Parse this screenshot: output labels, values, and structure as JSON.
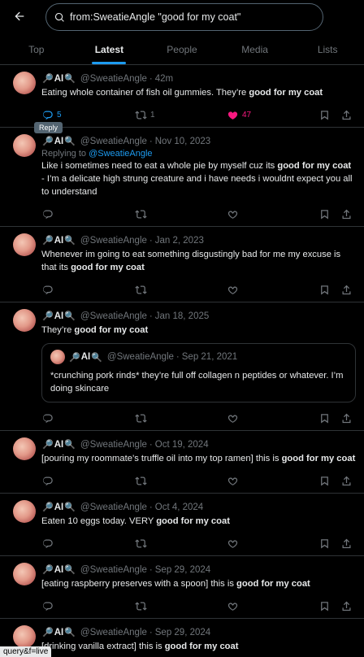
{
  "search": {
    "query": "from:SweatieAngle \"good for my coat\""
  },
  "tabs": [
    "Top",
    "Latest",
    "People",
    "Media",
    "Lists"
  ],
  "author": {
    "name_prefix": "AI",
    "handle": "@SweatieAngle"
  },
  "tweets": [
    {
      "time": "42m",
      "text_before": "Eating whole container of fish oil gummies. They’re ",
      "text_bold": "good for my coat",
      "text_after": "",
      "replies": "5",
      "retweets": "1",
      "likes": "47"
    },
    {
      "time": "Nov 10, 2023",
      "replying_label": "Replying to ",
      "replying_to": "@SweatieAngle",
      "text_before": "Like i sometimes need to eat a whole pie by myself cuz its ",
      "text_bold": "good for my coat",
      "text_after": " - I’m a delicate high strung creature and i have needs i wouldnt expect you all to understand"
    },
    {
      "time": "Jan 2, 2023",
      "text_before": "Whenever im going to eat something disgustingly bad for me my excuse is that its ",
      "text_bold": "good for my coat",
      "text_after": ""
    },
    {
      "time": "Jan 18, 2025",
      "text_before": "They’re ",
      "text_bold": "good for my coat",
      "text_after": "",
      "quote": {
        "time": "Sep 21, 2021",
        "text": "*crunching pork rinds* they’re full off collagen n peptides or whatever. I’m doing skincare"
      }
    },
    {
      "time": "Oct 19, 2024",
      "text_before": "[pouring my roommate’s truffle oil into my top ramen] this is ",
      "text_bold": "good for my coat",
      "text_after": ""
    },
    {
      "time": "Oct 4, 2024",
      "text_before": "Eaten 10 eggs today. VERY ",
      "text_bold": "good for my coat",
      "text_after": ""
    },
    {
      "time": "Sep 29, 2024",
      "text_before": "[eating raspberry preserves with a spoon] this is ",
      "text_bold": "good for my coat",
      "text_after": ""
    },
    {
      "time": "Sep 29, 2024",
      "text_before": "[drinking vanilla extract] this is ",
      "text_bold": "good for my coat",
      "text_after": ""
    }
  ],
  "tooltip": "Reply",
  "status_url": "query&f=live",
  "colors": {
    "accent": "#1d9bf0",
    "like": "#f91880",
    "muted": "#71767b"
  },
  "icons": [
    "back-arrow-icon",
    "search-icon",
    "reply-icon",
    "retweet-icon",
    "heart-icon",
    "bookmark-icon",
    "share-icon",
    "magnifier-emoji-icon"
  ]
}
